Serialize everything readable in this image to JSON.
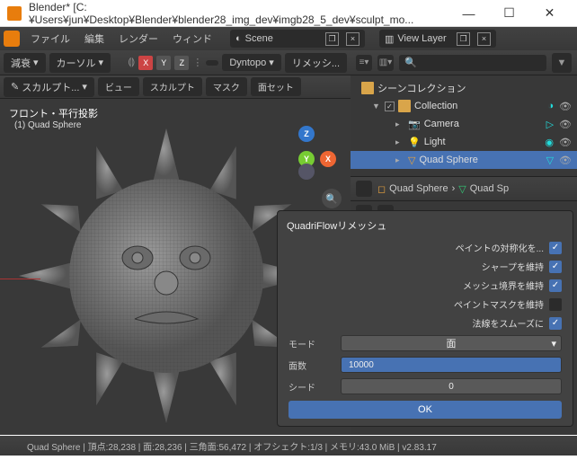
{
  "window": {
    "title": "Blender* [C:¥Users¥jun¥Desktop¥Blender¥blender28_img_dev¥imgb28_5_dev¥sculpt_mo...",
    "min": "—",
    "max": "☐",
    "close": "✕"
  },
  "topmenu": {
    "file": "ファイル",
    "edit": "編集",
    "render": "レンダー",
    "window": "ウィンド"
  },
  "scene": {
    "label": "Scene"
  },
  "viewlayer": {
    "label": "View Layer"
  },
  "vp": {
    "falloff": "減衰",
    "cursor": "カーソル",
    "dyntopo": "Dyntopo",
    "remesh": "リメッシ...",
    "mode": "スカルプト...",
    "view": "ビュー",
    "sculpt": "スカルプト",
    "mask": "マスク",
    "faceset": "面セット",
    "info": "フロント・平行投影",
    "item": "(1) Quad Sphere"
  },
  "outliner": {
    "scene_collection": "シーンコレクション",
    "collection": "Collection",
    "camera": "Camera",
    "light": "Light",
    "quad": "Quad Sphere"
  },
  "props": {
    "crumb1": "Quad Sphere",
    "crumb2": "Quad Sp"
  },
  "panel": {
    "title": "QuadriFlowリメッシュ",
    "symmetrize": "ペイントの対称化を...",
    "sharp": "シャープを維持",
    "boundary": "メッシュ境界を維持",
    "paintmask": "ペイントマスクを維持",
    "smooth": "法線をスムーズに",
    "mode": "モード",
    "mode_val": "面",
    "faces": "面数",
    "faces_val": "10000",
    "seed": "シード",
    "seed_val": "0",
    "ok": "OK"
  },
  "status": "Quad Sphere | 頂点:28,238 | 面:28,236 | 三角面:56,472 | オフシェクト:1/3 | メモリ:43.0 MiB | v2.83.17"
}
